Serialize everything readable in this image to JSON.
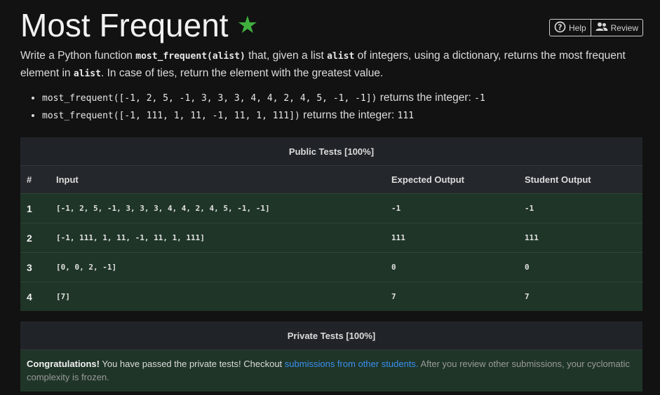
{
  "header": {
    "title": "Most Frequent",
    "star_icon": "star-icon",
    "help_label": "Help",
    "review_label": "Review"
  },
  "description": {
    "part1": "Write a Python function ",
    "func_sig": "most_frequent(alist)",
    "part2": " that, given a list ",
    "param": "alist",
    "part3": " of integers, using a dictionary, returns the most frequent element in ",
    "param2": "alist",
    "part4": ". In case of ties, return the element with the greatest value."
  },
  "examples": [
    {
      "call": "most_frequent([-1, 2, 5, -1, 3, 3, 3, 4, 4, 2, 4, 5, -1, -1])",
      "text": " returns the integer: ",
      "result": "-1"
    },
    {
      "call": "most_frequent([-1, 111, 1, 11, -1, 11, 1, 111])",
      "text": " returns the integer: ",
      "result": "111"
    }
  ],
  "public_tests": {
    "heading": "Public Tests [100%]",
    "columns": [
      "#",
      "Input",
      "Expected Output",
      "Student Output"
    ],
    "rows": [
      {
        "n": "1",
        "input": "[-1, 2, 5, -1, 3, 3, 3, 4, 4, 2, 4, 5, -1, -1]",
        "expected": "-1",
        "student": "-1"
      },
      {
        "n": "2",
        "input": "[-1, 111, 1, 11, -1, 11, 1, 111]",
        "expected": "111",
        "student": "111"
      },
      {
        "n": "3",
        "input": "[0, 0, 2, -1]",
        "expected": "0",
        "student": "0"
      },
      {
        "n": "4",
        "input": "[7]",
        "expected": "7",
        "student": "7"
      }
    ]
  },
  "private_tests": {
    "heading": "Private Tests [100%]",
    "congrats": "Congratulations!",
    "message": " You have passed the private tests! Checkout ",
    "link": "submissions from other students.",
    "note": " After you review other submissions, your cyclomatic complexity is frozen."
  },
  "colors": {
    "background": "#121212",
    "star": "#3fae3f",
    "pass_row": "#1f3528",
    "link": "#3b8ff0"
  }
}
